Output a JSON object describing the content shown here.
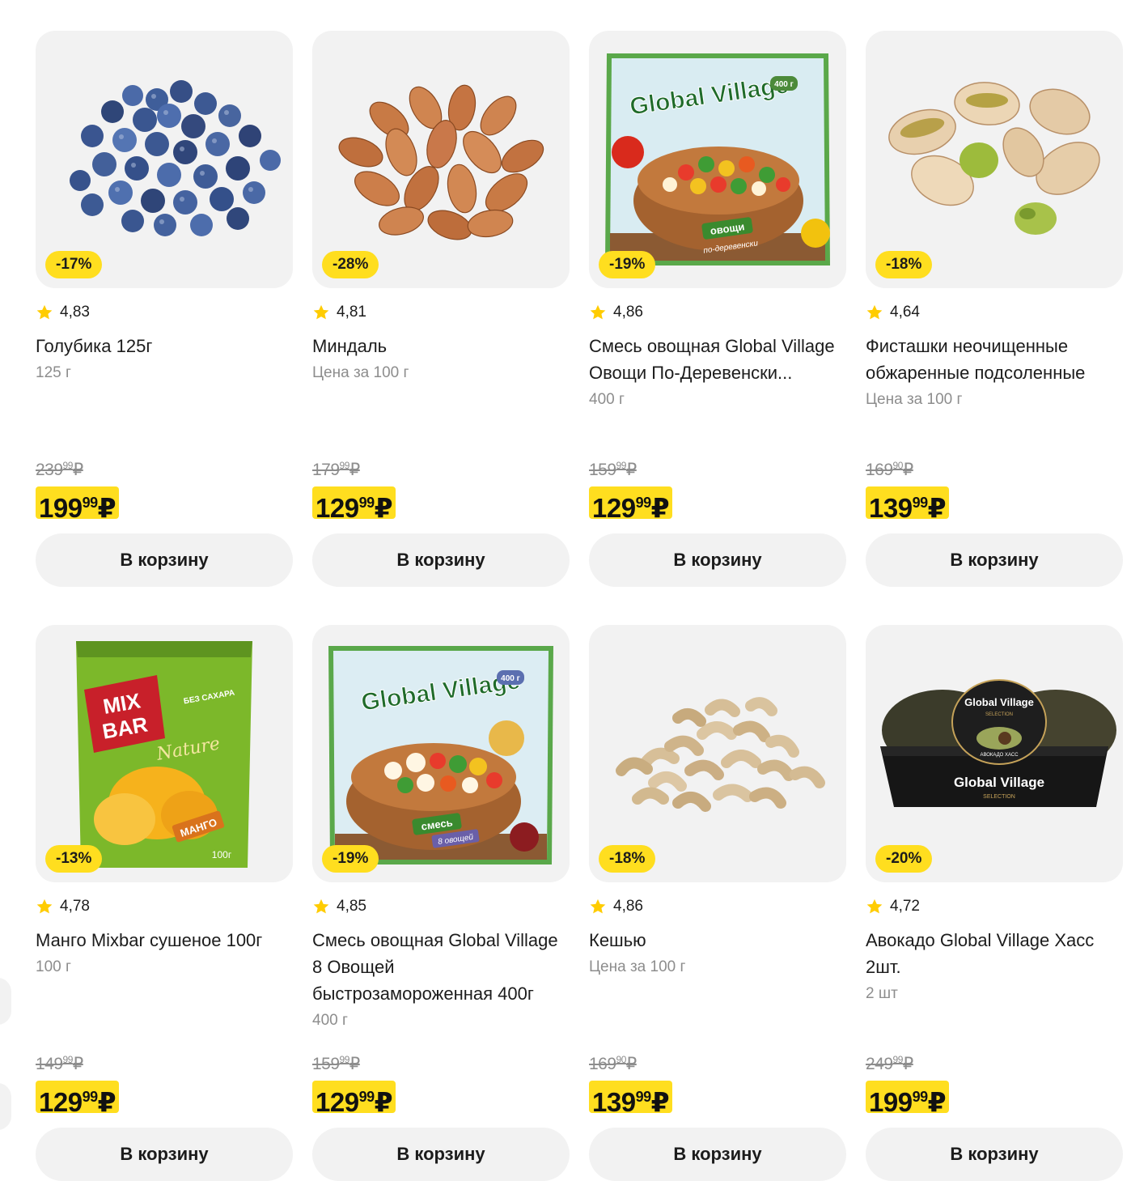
{
  "currency": "₽",
  "cart_label": "В корзину",
  "products": [
    {
      "discount": "-17%",
      "rating": "4,83",
      "name": "Голубика 125г",
      "unit": "125 г",
      "old_price_int": "239",
      "old_price_cents": "99",
      "price_int": "199",
      "price_cents": "99",
      "image_icon": "blueberries-image"
    },
    {
      "discount": "-28%",
      "rating": "4,81",
      "name": "Миндаль",
      "unit": "Цена за 100 г",
      "old_price_int": "179",
      "old_price_cents": "99",
      "price_int": "129",
      "price_cents": "99",
      "image_icon": "almonds-image"
    },
    {
      "discount": "-19%",
      "rating": "4,86",
      "name": "Смесь овощная Global Village Овощи По-Деревенски...",
      "unit": "400 г",
      "old_price_int": "159",
      "old_price_cents": "99",
      "price_int": "129",
      "price_cents": "99",
      "image_icon": "vegetable-mix-package-image"
    },
    {
      "discount": "-18%",
      "rating": "4,64",
      "name": "Фисташки неочищенные обжаренные подсоленные",
      "unit": "Цена за 100 г",
      "old_price_int": "169",
      "old_price_cents": "90",
      "price_int": "139",
      "price_cents": "99",
      "image_icon": "pistachios-image"
    },
    {
      "discount": "-13%",
      "rating": "4,78",
      "name": "Манго Mixbar сушеное 100г",
      "unit": "100 г",
      "old_price_int": "149",
      "old_price_cents": "99",
      "price_int": "129",
      "price_cents": "99",
      "image_icon": "dried-mango-package-image"
    },
    {
      "discount": "-19%",
      "rating": "4,85",
      "name": "Смесь овощная Global Village 8 Овощей быстрозамороженная 400г",
      "unit": "400 г",
      "old_price_int": "159",
      "old_price_cents": "99",
      "price_int": "129",
      "price_cents": "99",
      "image_icon": "vegetable-mix-package-image"
    },
    {
      "discount": "-18%",
      "rating": "4,86",
      "name": "Кешью",
      "unit": "Цена за 100 г",
      "old_price_int": "169",
      "old_price_cents": "90",
      "price_int": "139",
      "price_cents": "99",
      "image_icon": "cashews-image"
    },
    {
      "discount": "-20%",
      "rating": "4,72",
      "name": "Авокадо Global Village Хасс 2шт.",
      "unit": "2 шт",
      "old_price_int": "249",
      "old_price_cents": "99",
      "price_int": "199",
      "price_cents": "99",
      "image_icon": "avocado-package-image"
    }
  ],
  "packaging": {
    "brand": "Global Village",
    "weight": "400 г",
    "veg1_label": "овощи",
    "veg1_sub": "по-деревенски",
    "veg2_label": "смесь",
    "veg2_sub": "8 овощей",
    "mix_brand1": "MIX",
    "mix_brand2": "BAR",
    "mix_nature": "Nature",
    "mix_flavor": "МАНГО",
    "mix_sugar": "БЕЗ САХАРА",
    "mix_weight": "100г",
    "avocado_sub": "АВОКАДО ХАСС",
    "avocado_selection": "SELECTION"
  },
  "colors": {
    "accent": "#ffde1f",
    "card_bg": "#f2f2f2",
    "muted_text": "#8d8d8d"
  }
}
